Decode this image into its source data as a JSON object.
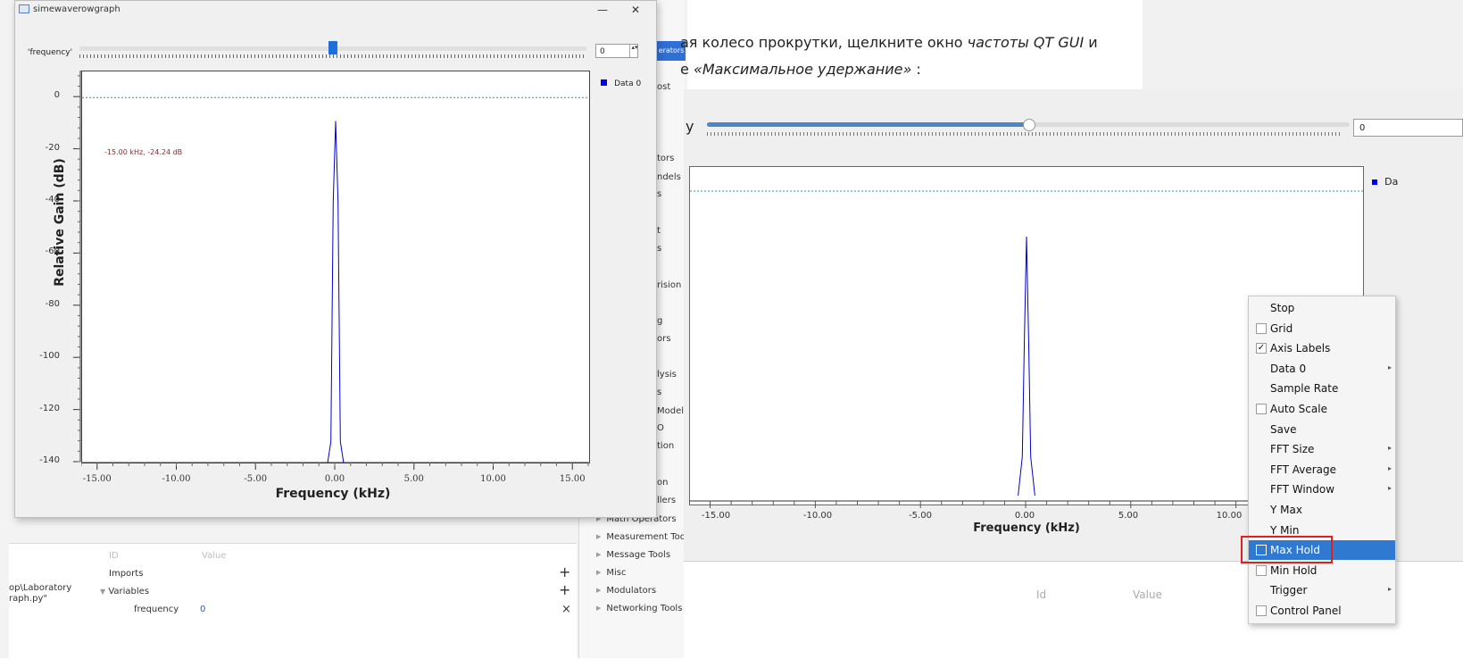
{
  "window": {
    "title": "simewaverowgraph",
    "minimize_glyph": "—",
    "close_glyph": "✕"
  },
  "control": {
    "label": "'frequency'",
    "value": "0",
    "spin_glyph": "▴▾",
    "slider_level": 0.5
  },
  "plot1": {
    "ylabel": "Relative Gain (dB)",
    "xlabel": "Frequency (kHz)",
    "y_ticks": [
      "0",
      "-20",
      "-40",
      "-60",
      "-80",
      "-100",
      "-120",
      "-140"
    ],
    "x_ticks": [
      "-15.00",
      "-10.00",
      "-5.00",
      "0.00",
      "5.00",
      "10.00",
      "15.00"
    ],
    "marker_text": "-15.00 kHz, -24.24 dB",
    "legend": "Data 0"
  },
  "chart_data": [
    {
      "type": "line",
      "xlabel": "Frequency (kHz)",
      "ylabel": "Relative Gain (dB)",
      "xlim": [
        -16,
        16
      ],
      "ylim": [
        -140,
        10
      ],
      "x": [
        -15,
        -1,
        -0.5,
        -0.3,
        -0.15,
        0,
        0.15,
        0.3,
        0.5,
        1,
        15
      ],
      "series": [
        {
          "name": "Data 0",
          "values": [
            -140,
            -140,
            -140,
            -132,
            -40,
            -9,
            -40,
            -132,
            -140,
            -140,
            -140
          ]
        }
      ],
      "grid": false,
      "legend_position": "right"
    },
    {
      "type": "line",
      "xlabel": "Frequency (kHz)",
      "xlim": [
        -16,
        16
      ],
      "x": [
        -0.4,
        -0.2,
        -0.1,
        0,
        0.1,
        0.2,
        0.4
      ],
      "series": [
        {
          "values": [
            0.0,
            0.15,
            0.6,
            1.0,
            0.6,
            0.15,
            0.0
          ]
        }
      ],
      "grid": false
    }
  ],
  "background": {
    "block_list": [
      "Math Operators",
      "Measurement Tool",
      "Message Tools",
      "Misc",
      "Modulators",
      "Networking Tools"
    ],
    "block_fragments": [
      "erators",
      "ost",
      "tors",
      "ndels",
      "s",
      "t",
      "s",
      "rision",
      "g",
      "ors",
      "lysis",
      "s",
      "Model",
      "O",
      "tion",
      "on",
      "llers"
    ],
    "vars_header_id": "ID",
    "vars_header_value": "Value",
    "tree": {
      "imports": "Imports",
      "variables": "Variables",
      "freq_name": "frequency",
      "freq_value": "0",
      "path_line1": "op\\Laboratory",
      "path_line2": "raph.py\""
    },
    "plus_glyph": "+",
    "x_glyph": "×"
  },
  "doc": {
    "line1_a": "ая колесо прокрутки, щелкните окно ",
    "line1_b": "частоты QT GUI",
    "line1_c": " и",
    "line2_a": "е ",
    "line2_b": "«Максимальное удержание»",
    "line2_c": " :"
  },
  "gui2": {
    "label_fragment": "y",
    "value": "0",
    "legend_fragment": "Da",
    "xlabel": "Frequency (kHz)",
    "x_ticks": [
      "-15.00",
      "-10.00",
      "-5.00",
      "0.00",
      "5.00",
      "10.00"
    ],
    "bottom_id": "Id",
    "bottom_value": "Value",
    "slider_level": 0.5
  },
  "context_menu": {
    "items": [
      {
        "label": "Stop",
        "checkbox": false,
        "submenu": false
      },
      {
        "label": "Grid",
        "checkbox": true,
        "checked": false,
        "submenu": false
      },
      {
        "label": "Axis Labels",
        "checkbox": true,
        "checked": true,
        "submenu": false
      },
      {
        "label": "Data 0",
        "checkbox": false,
        "submenu": true
      },
      {
        "label": "Sample Rate",
        "checkbox": false,
        "submenu": false
      },
      {
        "label": "Auto Scale",
        "checkbox": true,
        "checked": false,
        "submenu": false
      },
      {
        "label": "Save",
        "checkbox": false,
        "submenu": false
      },
      {
        "label": "FFT Size",
        "checkbox": false,
        "submenu": true
      },
      {
        "label": "FFT Average",
        "checkbox": false,
        "submenu": true
      },
      {
        "label": "FFT Window",
        "checkbox": false,
        "submenu": true
      },
      {
        "label": "Y Max",
        "checkbox": false,
        "submenu": false
      },
      {
        "label": "Y Min",
        "checkbox": false,
        "submenu": false
      },
      {
        "label": "Max Hold",
        "checkbox": true,
        "checked": false,
        "submenu": false,
        "highlighted": true
      },
      {
        "label": "Min Hold",
        "checkbox": true,
        "checked": false,
        "submenu": false
      },
      {
        "label": "Trigger",
        "checkbox": false,
        "submenu": true
      },
      {
        "label": "Control Panel",
        "checkbox": true,
        "checked": false,
        "submenu": false
      }
    ],
    "check_glyph": "✓",
    "submenu_glyph": "▸"
  },
  "colors": {
    "trace": "#0000cc",
    "ref_line_top": "#1aa3a3",
    "ref_line_bottom": "#7a7a1a",
    "highlight": "#2f79d0",
    "annotation_box": "#e02020"
  }
}
